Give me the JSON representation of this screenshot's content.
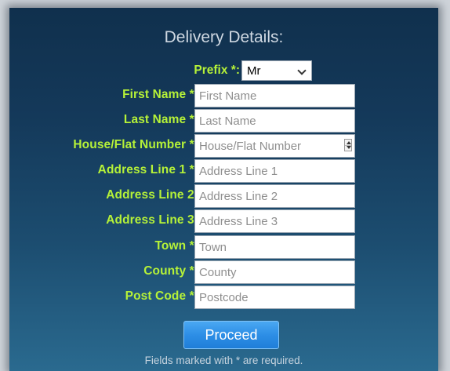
{
  "form": {
    "title": "Delivery Details:",
    "prefix": {
      "label": "Prefix *:",
      "selected": "Mr"
    },
    "fields": [
      {
        "label": "First Name *:",
        "placeholder": "First Name"
      },
      {
        "label": "Last Name *:",
        "placeholder": "Last Name"
      },
      {
        "label": "House/Flat Number *:",
        "placeholder": "House/Flat Number"
      },
      {
        "label": "Address Line 1 *:",
        "placeholder": "Address Line 1"
      },
      {
        "label": "Address Line 2:",
        "placeholder": "Address Line 2"
      },
      {
        "label": "Address Line 3:",
        "placeholder": "Address Line 3"
      },
      {
        "label": "Town *:",
        "placeholder": "Town"
      },
      {
        "label": "County *:",
        "placeholder": "County"
      },
      {
        "label": "Post Code *:",
        "placeholder": "Postcode"
      }
    ],
    "proceed_label": "Proceed",
    "required_note": "Fields marked with * are required."
  },
  "colors": {
    "label": "#b6f238",
    "button": "#2d8ee6",
    "panel_top": "#10304d",
    "panel_bottom": "#2a6a8f"
  },
  "icons": {
    "prefix_dropdown": "chevron-down-icon",
    "house_number_spinner": "number-spinner-icon"
  }
}
